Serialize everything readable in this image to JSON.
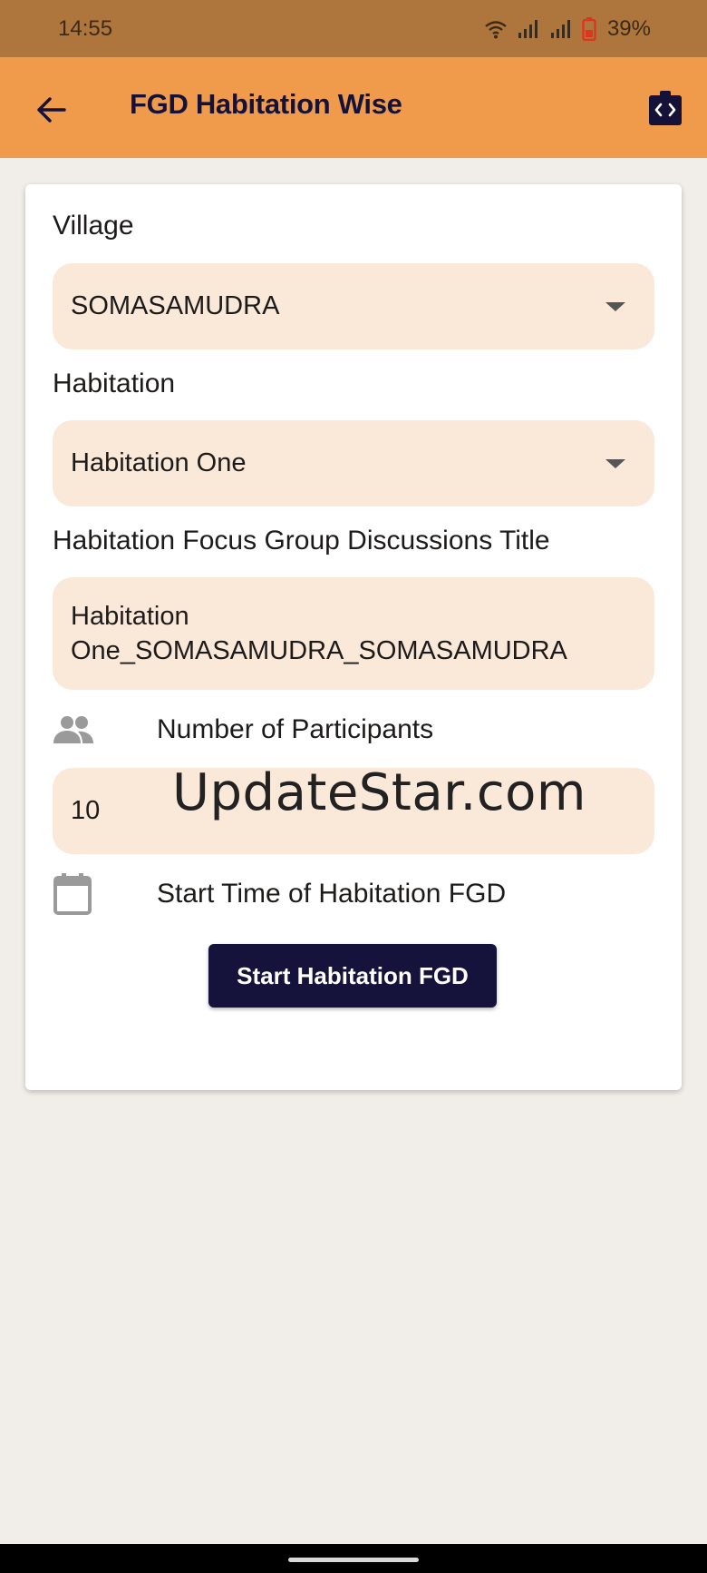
{
  "status_bar": {
    "time": "14:55",
    "battery_percent": "39%",
    "icons": [
      "wifi-icon",
      "signal-icon",
      "signal-icon",
      "battery-low-icon"
    ]
  },
  "app_bar": {
    "title": "FGD Habitation Wise",
    "back_icon": "arrow-left-icon",
    "action_icon": "code-clipboard-icon"
  },
  "form": {
    "village": {
      "label": "Village",
      "value": "SOMASAMUDRA"
    },
    "habitation": {
      "label": "Habitation",
      "value": "Habitation One"
    },
    "fgd_title": {
      "label": "Habitation Focus Group Discussions Title",
      "value_line1": "Habitation",
      "value_line2": "One_SOMASAMUDRA_SOMASAMUDRA"
    },
    "participants": {
      "label": "Number of Participants",
      "value": "10",
      "icon": "people-icon"
    },
    "start_time": {
      "label": "Start Time of Habitation FGD",
      "icon": "calendar-icon"
    },
    "submit_label": "Start Habitation FGD"
  },
  "watermark": "UpdateStar.com",
  "colors": {
    "status_bar": "#ae763c",
    "app_bar": "#ef9b4b",
    "field_bg": "#fae8d9",
    "primary": "#15133c",
    "background": "#f1ede8"
  }
}
